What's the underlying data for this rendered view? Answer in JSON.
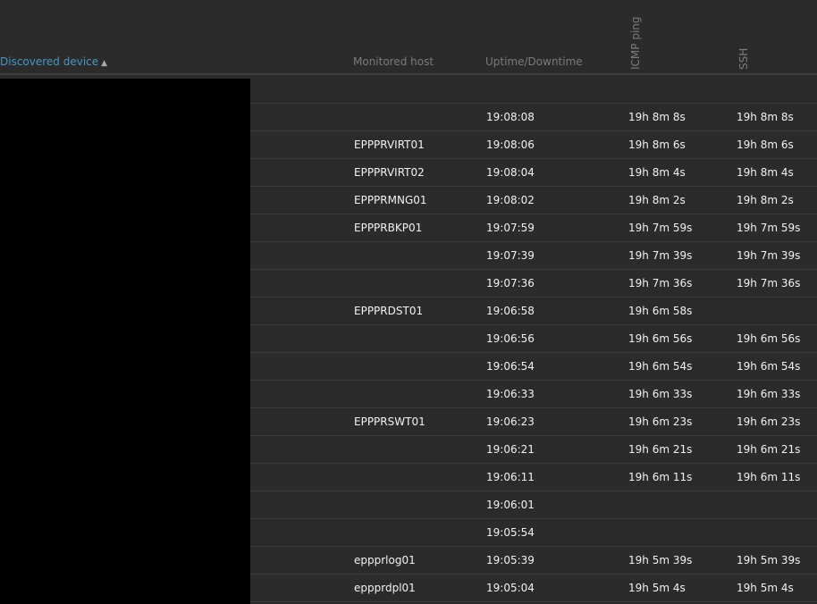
{
  "header": {
    "discovered_device": "Discovered device",
    "sort_indicator": "▲",
    "monitored_host": "Monitored host",
    "uptime": "Uptime/Downtime",
    "icmp": "ICMP ping",
    "ssh": "SSH"
  },
  "rows": [
    {
      "host": "",
      "uptime": "",
      "icmp": "",
      "ssh": ""
    },
    {
      "host": "",
      "uptime": "19:08:08",
      "icmp": "19h 8m 8s",
      "ssh": "19h 8m 8s"
    },
    {
      "host": "EPPPRVIRT01",
      "uptime": "19:08:06",
      "icmp": "19h 8m 6s",
      "ssh": "19h 8m 6s"
    },
    {
      "host": "EPPPRVIRT02",
      "uptime": "19:08:04",
      "icmp": "19h 8m 4s",
      "ssh": "19h 8m 4s"
    },
    {
      "host": "EPPPRMNG01",
      "uptime": "19:08:02",
      "icmp": "19h 8m 2s",
      "ssh": "19h 8m 2s"
    },
    {
      "host": "EPPPRBKP01",
      "uptime": "19:07:59",
      "icmp": "19h 7m 59s",
      "ssh": "19h 7m 59s"
    },
    {
      "host": "",
      "uptime": "19:07:39",
      "icmp": "19h 7m 39s",
      "ssh": "19h 7m 39s"
    },
    {
      "host": "",
      "uptime": "19:07:36",
      "icmp": "19h 7m 36s",
      "ssh": "19h 7m 36s"
    },
    {
      "host": "EPPPRDST01",
      "uptime": "19:06:58",
      "icmp": "19h 6m 58s",
      "ssh": ""
    },
    {
      "host": "",
      "uptime": "19:06:56",
      "icmp": "19h 6m 56s",
      "ssh": "19h 6m 56s"
    },
    {
      "host": "",
      "uptime": "19:06:54",
      "icmp": "19h 6m 54s",
      "ssh": "19h 6m 54s"
    },
    {
      "host": "",
      "uptime": "19:06:33",
      "icmp": "19h 6m 33s",
      "ssh": "19h 6m 33s"
    },
    {
      "host": "EPPPRSWT01",
      "uptime": "19:06:23",
      "icmp": "19h 6m 23s",
      "ssh": "19h 6m 23s"
    },
    {
      "host": "",
      "uptime": "19:06:21",
      "icmp": "19h 6m 21s",
      "ssh": "19h 6m 21s"
    },
    {
      "host": "",
      "uptime": "19:06:11",
      "icmp": "19h 6m 11s",
      "ssh": "19h 6m 11s"
    },
    {
      "host": "",
      "uptime": "19:06:01",
      "icmp": "",
      "ssh": ""
    },
    {
      "host": "",
      "uptime": "19:05:54",
      "icmp": "",
      "ssh": ""
    },
    {
      "host": "eppprlog01",
      "uptime": "19:05:39",
      "icmp": "19h 5m 39s",
      "ssh": "19h 5m 39s"
    },
    {
      "host": "eppprdpl01",
      "uptime": "19:05:04",
      "icmp": "19h 5m 4s",
      "ssh": "19h 5m 4s"
    }
  ]
}
